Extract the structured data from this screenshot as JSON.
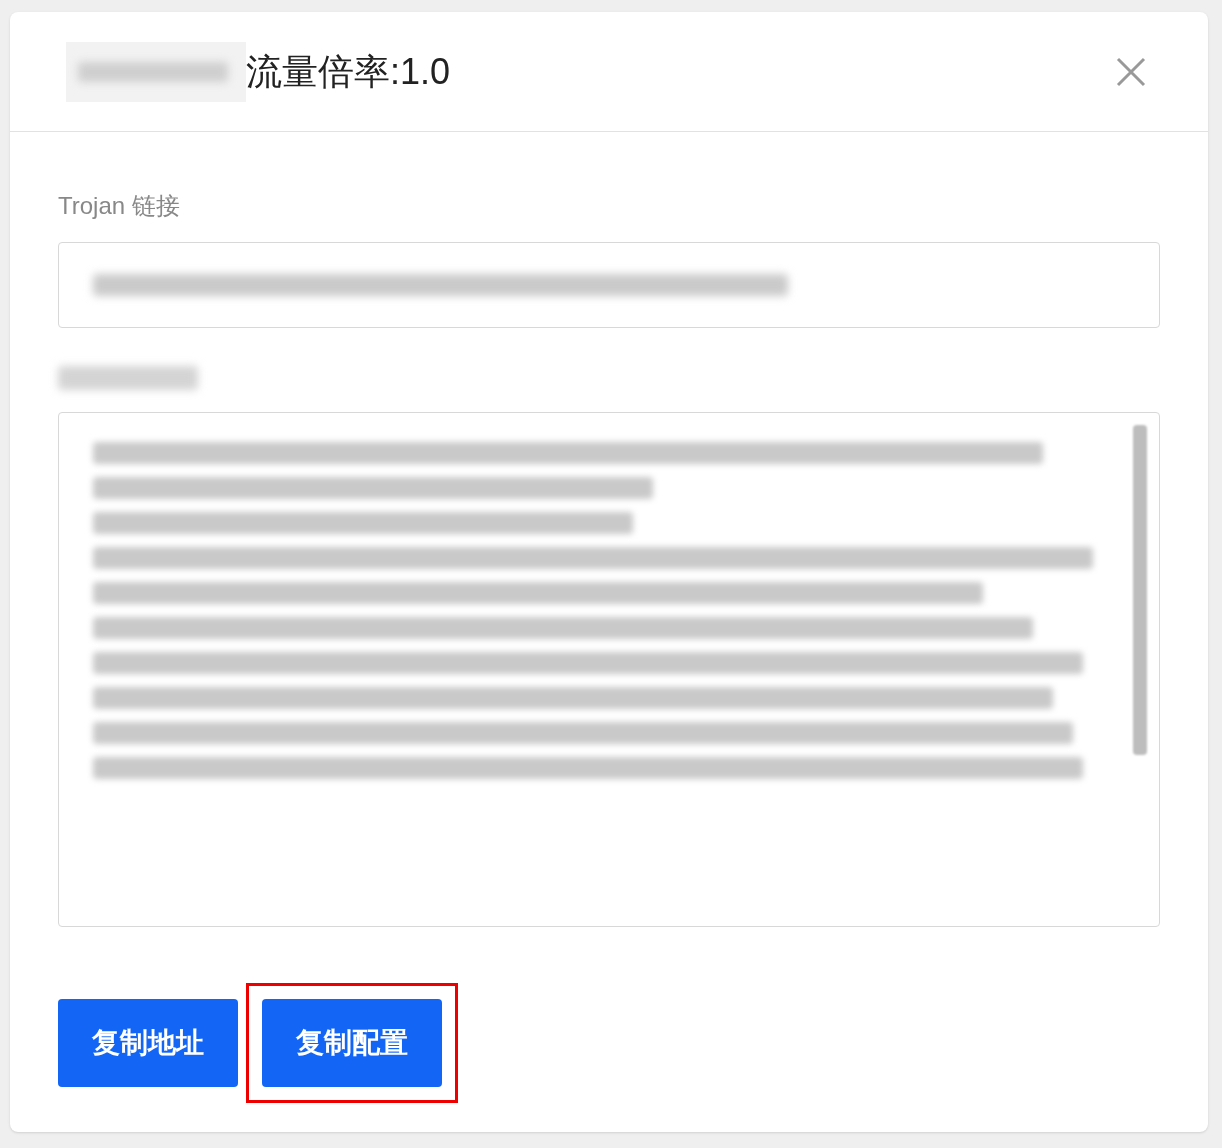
{
  "dialog": {
    "title": "流量倍率:1.0"
  },
  "link_field": {
    "label": "Trojan 链接"
  },
  "buttons": [
    {
      "label": "复制地址",
      "highlighted": false
    },
    {
      "label": "复制配置",
      "highlighted": true
    }
  ]
}
